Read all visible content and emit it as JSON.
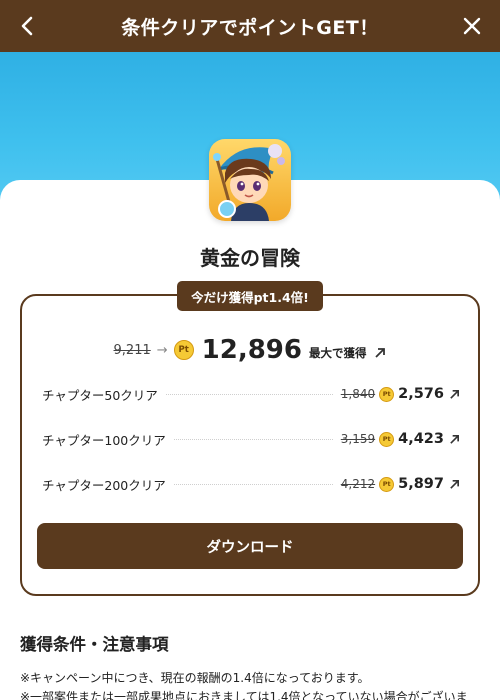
{
  "header": {
    "title": "条件クリアでポイントGET！",
    "back_icon": "chevron-left-icon",
    "close_icon": "close-icon"
  },
  "colors": {
    "brand_brown": "#5a3a1e",
    "banner_blue": "#3fc0ee",
    "coin_gold": "#f5c935"
  },
  "app": {
    "name": "黄金の冒険",
    "icon": "game-character-icon"
  },
  "promo": {
    "badge": "今だけ獲得pt1.4倍!"
  },
  "reward": {
    "old_total": "9,211",
    "arrow": "→",
    "coin_label": "Pt",
    "new_total": "12,896",
    "max_label": "最大で獲得"
  },
  "chapters": [
    {
      "label": "チャプター50クリア",
      "old": "1,840",
      "new": "2,576"
    },
    {
      "label": "チャプター100クリア",
      "old": "3,159",
      "new": "4,423"
    },
    {
      "label": "チャプター200クリア",
      "old": "4,212",
      "new": "5,897"
    }
  ],
  "download": {
    "label": "ダウンロード"
  },
  "notes": {
    "heading": "獲得条件・注意事項",
    "lines": [
      "※キャンペーン中につき、現在の報酬の1.4倍になっております。",
      "※一部案件または一部成果地点におきましては1.4倍となっていない場合がございま"
    ]
  }
}
